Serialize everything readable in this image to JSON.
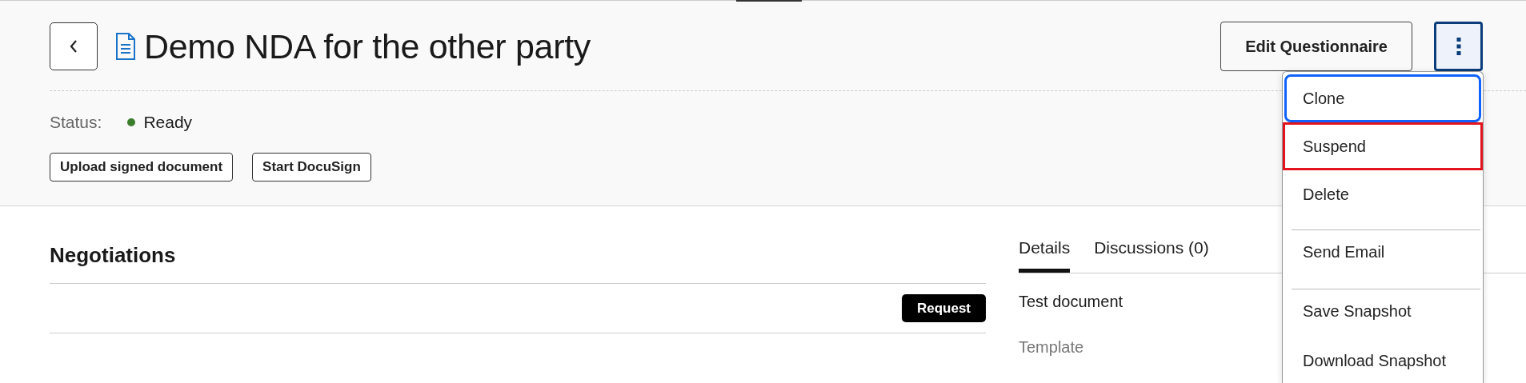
{
  "header": {
    "title": "Demo NDA for the other party",
    "edit_button": "Edit Questionnaire",
    "more_button": {
      "expanded": true
    },
    "status_label": "Status:",
    "status": "Ready",
    "actions": [
      "Upload signed document",
      "Start DocuSign"
    ]
  },
  "menu": {
    "items": [
      {
        "label": "Clone",
        "focused": true,
        "highlighted": false,
        "separated": false
      },
      {
        "label": "Suspend",
        "focused": false,
        "highlighted": true,
        "separated": false
      },
      {
        "label": "Delete",
        "focused": false,
        "highlighted": false,
        "separated": false
      },
      {
        "label": "Send Email",
        "focused": false,
        "highlighted": false,
        "separated": true
      },
      {
        "label": "Save Snapshot",
        "focused": false,
        "highlighted": false,
        "separated": true
      },
      {
        "label": "Download Snapshot",
        "focused": false,
        "highlighted": false,
        "separated": false
      }
    ]
  },
  "negotiations": {
    "title": "Negotiations",
    "request_button": "Request"
  },
  "details": {
    "tabs": [
      {
        "label": "Details",
        "selected": true
      },
      {
        "label": "Discussions (0)",
        "selected": false
      }
    ],
    "description": "Test document",
    "template_label": "Template"
  }
}
